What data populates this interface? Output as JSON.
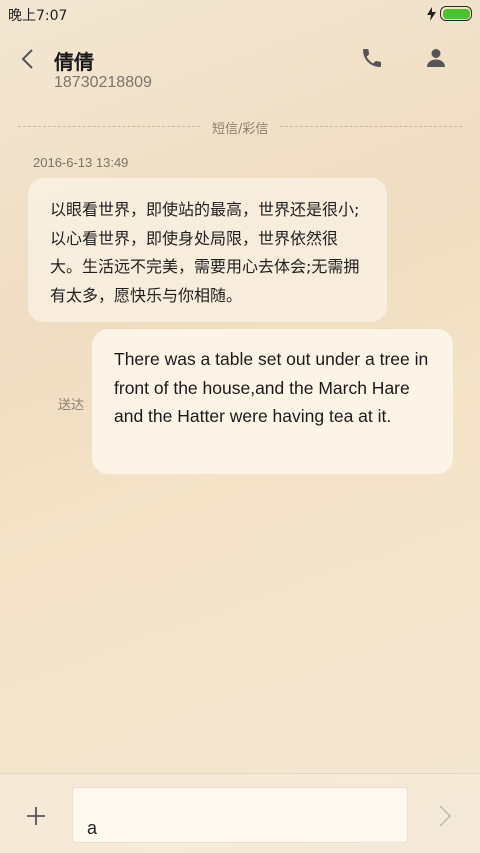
{
  "status_bar": {
    "time": "晚上7:07",
    "battery_fill_fraction": 1.0,
    "battery_color": "#4cc22f",
    "charging_icon": "lightning-icon"
  },
  "header": {
    "back_icon": "chevron-left-icon",
    "contact_name": "倩倩",
    "contact_number": "18730218809",
    "call_icon": "phone-icon",
    "profile_icon": "person-icon"
  },
  "thread": {
    "divider_label": "短信/彩信",
    "timestamp": "2016-6-13 13:49",
    "incoming_message": "以眼看世界，即使站的最高，世界还是很小;以心看世界，即使身处局限，世界依然很大。生活远不完美，需要用心去体会;无需拥有太多，愿快乐与你相随。",
    "outgoing_message": "There was a table set out under a tree in front of the house,and the March Hare and the Hatter were having tea at it.",
    "outgoing_status": "送达"
  },
  "composer": {
    "add_icon": "plus-icon",
    "input_value": "a",
    "send_icon": "chevron-right-icon"
  }
}
